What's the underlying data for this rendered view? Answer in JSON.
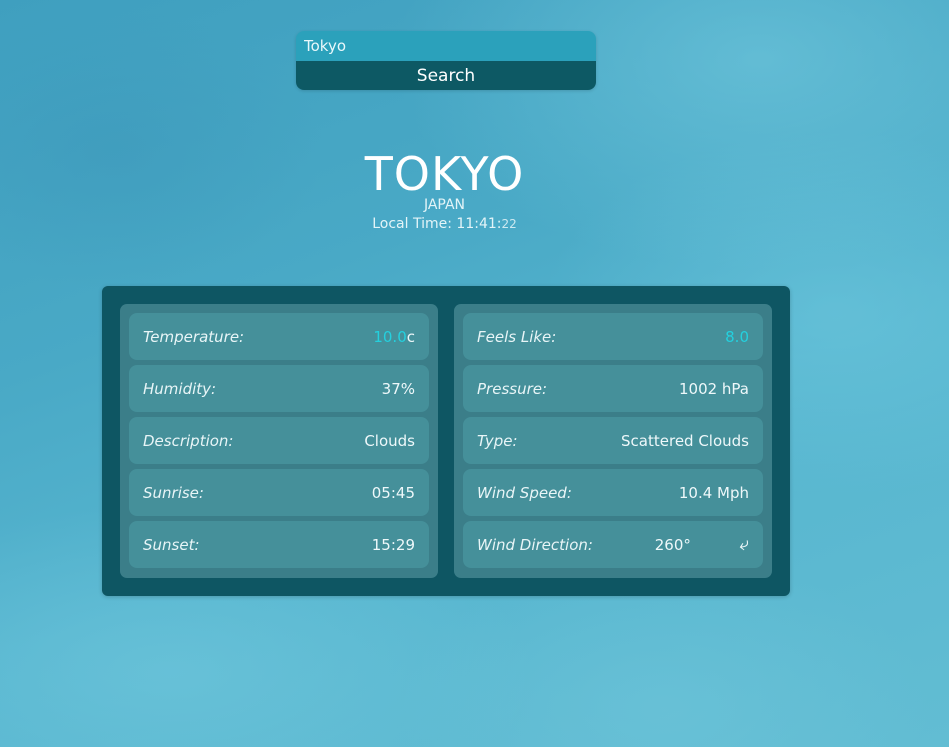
{
  "search": {
    "value": "Tokyo",
    "button_label": "Search"
  },
  "location": {
    "city": "TOKYO",
    "country": "JAPAN",
    "local_time_label": "Local Time:",
    "local_time_hm": "11:41:",
    "local_time_s": "22"
  },
  "weather_left": [
    {
      "label": "Temperature:",
      "value": "10.0",
      "unit": "c"
    },
    {
      "label": "Humidity:",
      "value": "37%"
    },
    {
      "label": "Description:",
      "value": "Clouds"
    },
    {
      "label": "Sunrise:",
      "value": "05:45"
    },
    {
      "label": "Sunset:",
      "value": "15:29"
    }
  ],
  "weather_right": [
    {
      "label": "Feels Like:",
      "value": "8.0"
    },
    {
      "label": "Pressure:",
      "value": "1002 hPa"
    },
    {
      "label": "Type:",
      "value": "Scattered Clouds"
    },
    {
      "label": "Wind Speed:",
      "value": "10.4 Mph"
    },
    {
      "label": "Wind Direction:",
      "value": "260°",
      "icon": "wind-arrow-icon"
    }
  ],
  "colors": {
    "accent": "#24d0de",
    "panel": "#0e5663",
    "search_button": "#0d5964",
    "search_input": "#2ba1bb"
  }
}
